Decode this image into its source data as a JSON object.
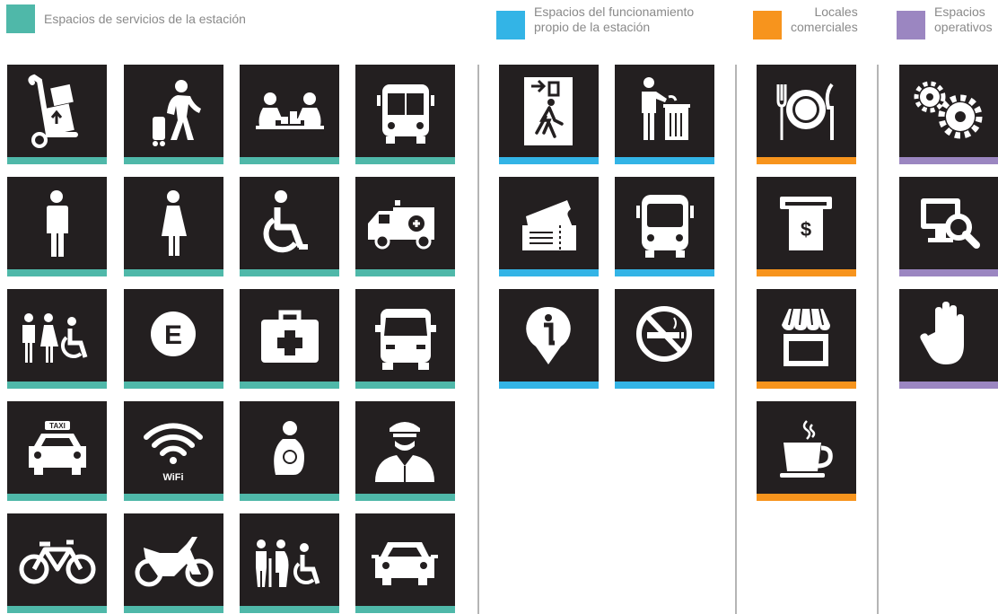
{
  "colors": {
    "servicios": "#4fb8a9",
    "funcionamiento": "#33b4e6",
    "comerciales": "#f7941d",
    "operativos": "#9b86c1",
    "tile": "#231f20"
  },
  "legend": {
    "servicios": "Espacios de servicios de la estación",
    "funcionamiento": "Espacios del funcionamiento\npropio de la estación",
    "comerciales": "Locales\ncomerciales",
    "operativos": "Espacios\noperativos"
  },
  "icons": {
    "servicios": [
      "luggage-cart-icon",
      "traveler-icon",
      "play-area-icon",
      "bus-icon",
      "men-restroom-icon",
      "women-restroom-icon",
      "wheelchair-icon",
      "ambulance-icon",
      "family-restroom-icon",
      "parking-e-icon",
      "first-aid-icon",
      "van-icon",
      "taxi-icon",
      "wifi-icon",
      "lactation-icon",
      "police-icon",
      "bicycle-icon",
      "motorcycle-icon",
      "priority-seating-icon",
      "car-icon"
    ],
    "funcionamiento": [
      "emergency-exit-icon",
      "trash-bin-icon",
      "ticket-icon",
      "bus-front-icon",
      "information-icon",
      "no-smoking-icon"
    ],
    "comerciales": [
      "restaurant-icon",
      "atm-icon",
      "store-icon",
      "coffee-icon"
    ],
    "operativos": [
      "gears-icon",
      "monitoring-icon",
      "stop-hand-icon"
    ]
  },
  "labels": {
    "wifi": "WiFi",
    "taxi": "TAXI",
    "parking": "E",
    "money": "$"
  }
}
